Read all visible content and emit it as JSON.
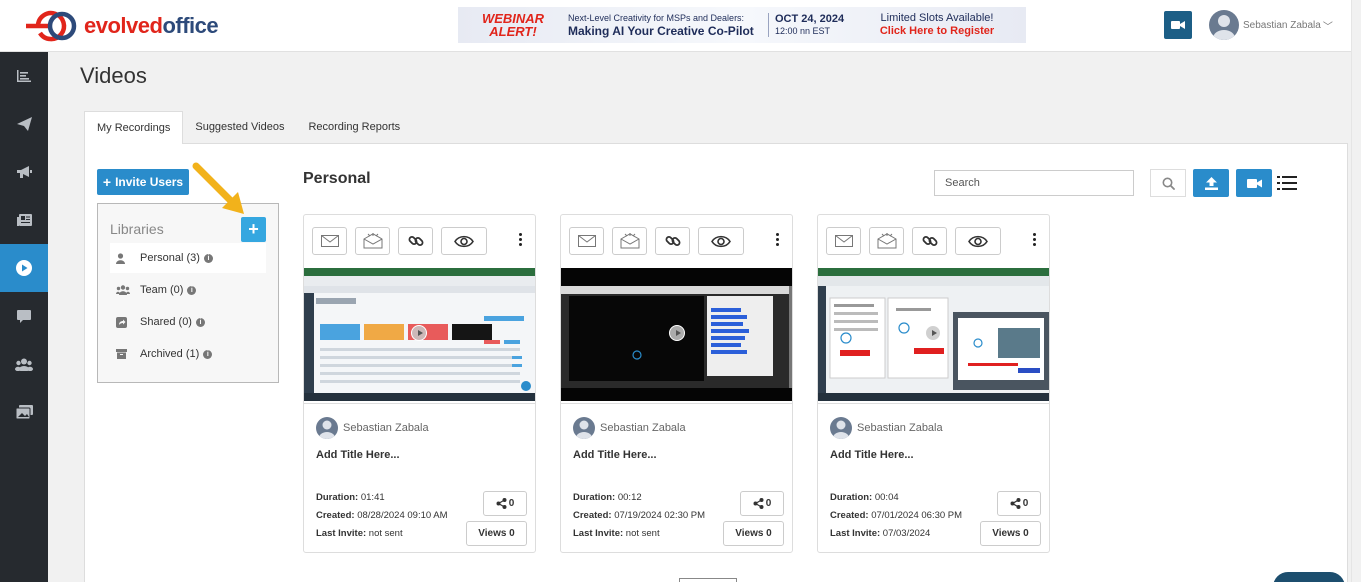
{
  "brand": {
    "logo_text_a": "evolved",
    "logo_text_b": "office"
  },
  "banner": {
    "alert_line1": "WEBINAR",
    "alert_line2": "ALERT!",
    "headline_small": "Next-Level Creativity for MSPs and Dealers:",
    "headline_big": "Making AI Your Creative Co-Pilot",
    "date": "OCT 24, 2024",
    "time": "12:00 nn EST",
    "cta_line1": "Limited Slots Available!",
    "cta_line2": "Click Here to Register"
  },
  "user": {
    "name": "Sebastian Zabala",
    "chevron": "﹀"
  },
  "sidebar": {
    "items": [
      {
        "name": "reports-icon",
        "active": false
      },
      {
        "name": "send-icon",
        "active": false
      },
      {
        "name": "megaphone-icon",
        "active": false
      },
      {
        "name": "newspaper-icon",
        "active": false
      },
      {
        "name": "video-play-icon",
        "active": true
      },
      {
        "name": "chat-icon",
        "active": false
      },
      {
        "name": "users-icon",
        "active": false
      },
      {
        "name": "media-icon",
        "active": false
      }
    ]
  },
  "page": {
    "title": "Videos"
  },
  "tabs": [
    {
      "label": "My Recordings",
      "active": true
    },
    {
      "label": "Suggested Videos",
      "active": false
    },
    {
      "label": "Recording Reports",
      "active": false
    }
  ],
  "invite": {
    "label": "Invite Users"
  },
  "libraries": {
    "title": "Libraries",
    "add_label": "+",
    "items": [
      {
        "label": "Personal (3)",
        "icon": "user-icon",
        "selected": true
      },
      {
        "label": "Team (0)",
        "icon": "team-icon",
        "selected": false
      },
      {
        "label": "Shared (0)",
        "icon": "share-square-icon",
        "selected": false
      },
      {
        "label": "Archived (1)",
        "icon": "archive-icon",
        "selected": false
      }
    ],
    "info_glyph": "i"
  },
  "section": {
    "title": "Personal"
  },
  "search": {
    "placeholder": "Search",
    "value": ""
  },
  "cards": [
    {
      "owner": "Sebastian Zabala",
      "title": "Add Title Here...",
      "duration_label": "Duration:",
      "duration": "01:41",
      "created_label": "Created:",
      "created": "08/28/2024 09:10 AM",
      "invite_label": "Last Invite:",
      "invite": "not sent",
      "shares": "0",
      "views": "Views 0"
    },
    {
      "owner": "Sebastian Zabala",
      "title": "Add Title Here...",
      "duration_label": "Duration:",
      "duration": "00:12",
      "created_label": "Created:",
      "created": "07/19/2024 02:30 PM",
      "invite_label": "Last Invite:",
      "invite": "not sent",
      "shares": "0",
      "views": "Views 0"
    },
    {
      "owner": "Sebastian Zabala",
      "title": "Add Title Here...",
      "duration_label": "Duration:",
      "duration": "00:04",
      "created_label": "Created:",
      "created": "07/01/2024 06:30 PM",
      "invite_label": "Last Invite:",
      "invite": "07/03/2024",
      "shares": "0",
      "views": "Views 0"
    }
  ],
  "colors": {
    "accent": "#2a8ccb",
    "sidebar": "#262a2f",
    "arrow": "#f2b21b",
    "brand_red": "#e1251b",
    "brand_navy": "#2d4a7a"
  }
}
